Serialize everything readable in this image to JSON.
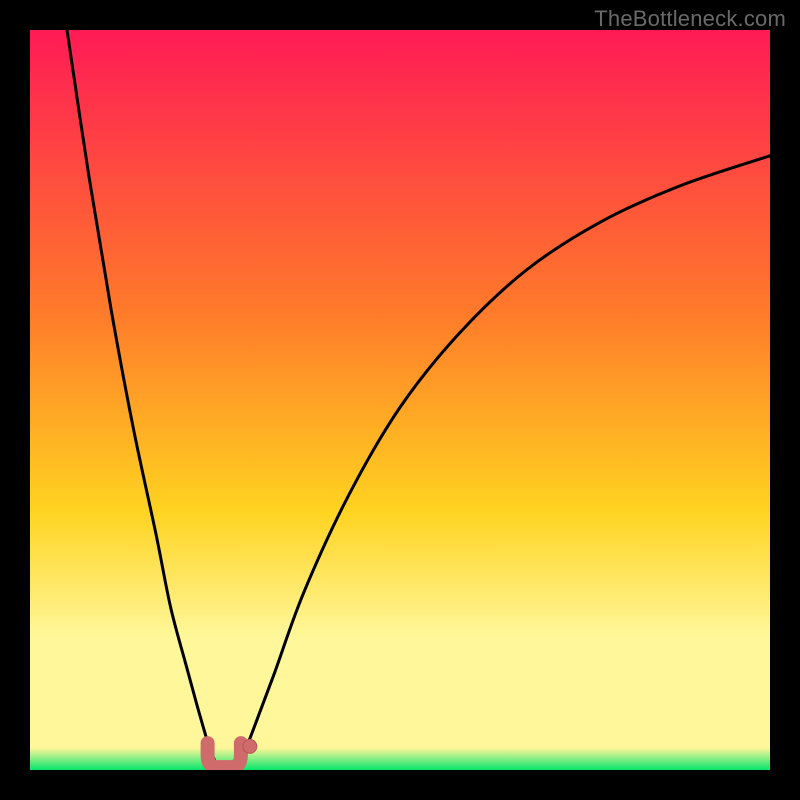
{
  "watermark": "TheBottleneck.com",
  "colors": {
    "top": "#ff1b55",
    "mid_upper_orange": "#ff7a2a",
    "mid_yellow": "#ffd320",
    "pale_band": "#fff79a",
    "green": "#06e66c",
    "curve": "#000000",
    "marker_fill": "#cf6b6b",
    "marker_stroke": "#b85454",
    "background": "#000000"
  },
  "chart_data": {
    "type": "line",
    "title": "",
    "xlabel": "",
    "ylabel": "",
    "xlim": [
      0,
      100
    ],
    "ylim": [
      0,
      100
    ],
    "gradient_stops": [
      {
        "pct": 0,
        "color": "#ff1b55"
      },
      {
        "pct": 38,
        "color": "#ff7a2a"
      },
      {
        "pct": 65,
        "color": "#ffd320"
      },
      {
        "pct": 82,
        "color": "#fff79a"
      },
      {
        "pct": 97,
        "color": "#fff79a"
      },
      {
        "pct": 100,
        "color": "#06e66c"
      }
    ],
    "series": [
      {
        "name": "left_branch",
        "x": [
          5.0,
          8.0,
          11.0,
          14.0,
          17.0,
          19.0,
          21.0,
          22.5,
          23.5,
          24.3,
          25.0
        ],
        "y": [
          100.0,
          80.0,
          62.0,
          46.0,
          32.0,
          22.0,
          14.5,
          9.0,
          5.5,
          2.8,
          1.2
        ]
      },
      {
        "name": "right_branch",
        "x": [
          28.5,
          30.0,
          33.0,
          37.0,
          43.0,
          50.0,
          58.0,
          67.0,
          77.0,
          88.0,
          100.0
        ],
        "y": [
          1.2,
          5.0,
          13.0,
          24.0,
          37.0,
          49.0,
          59.0,
          67.5,
          74.0,
          79.0,
          83.0
        ]
      }
    ],
    "trough_marker": {
      "x_range": [
        24.0,
        28.5
      ],
      "y": 1.2,
      "shape": "u",
      "dot": {
        "x": 29.7,
        "y": 3.2
      }
    }
  }
}
